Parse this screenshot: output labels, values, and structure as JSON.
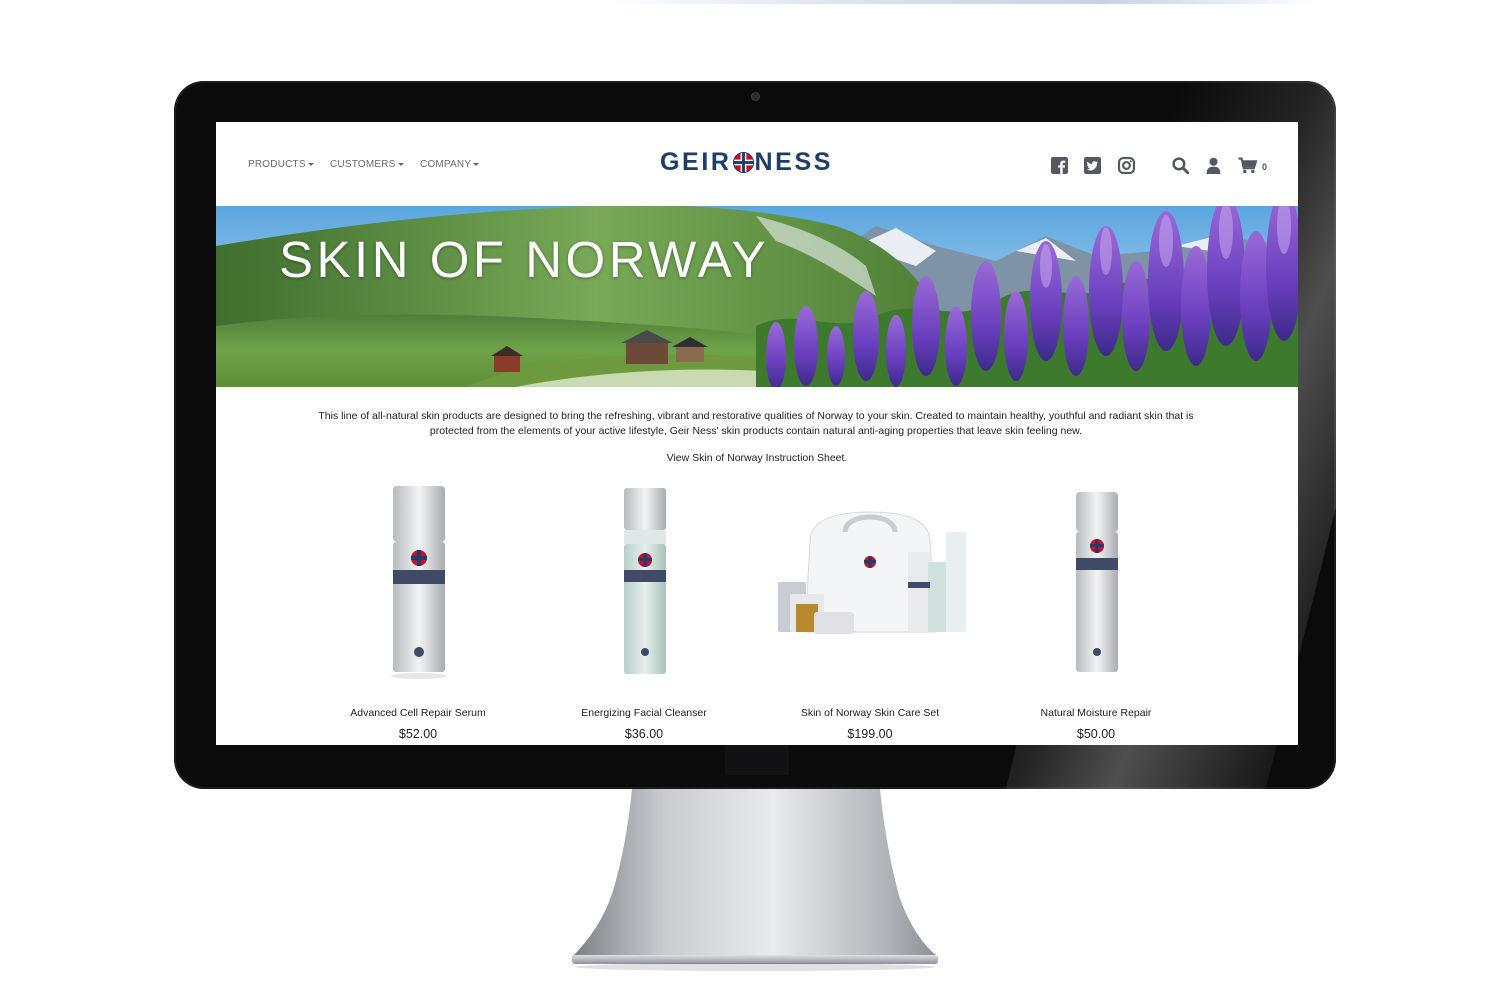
{
  "nav": {
    "menu": [
      {
        "label": "PRODUCTS"
      },
      {
        "label": "CUSTOMERS"
      },
      {
        "label": "COMPANY"
      }
    ],
    "logo_left": "GEIR",
    "logo_right": "NESS",
    "social_icons": [
      "facebook-icon",
      "twitter-icon",
      "instagram-icon"
    ],
    "utility_icons": [
      "search-icon",
      "user-icon",
      "cart-icon"
    ],
    "cart_count": "0"
  },
  "hero": {
    "title": "SKIN OF NORWAY"
  },
  "intro": {
    "text": "This line of all-natural skin products are designed to bring the refreshing, vibrant and restorative qualities of Norway to your skin. Created to maintain healthy, youthful and radiant skin that is protected from the elements of your active lifestyle, Geir Ness' skin products contain natural anti-aging properties that leave skin feeling new.",
    "link": "View Skin of Norway Instruction Sheet."
  },
  "products": [
    {
      "name": "Advanced Cell Repair Serum",
      "price": "$52.00"
    },
    {
      "name": "Energizing Facial Cleanser",
      "price": "$36.00"
    },
    {
      "name": "Skin of Norway Skin Care Set",
      "price": "$199.00"
    },
    {
      "name": "Natural Moisture Repair",
      "price": "$50.00"
    }
  ],
  "colors": {
    "brand_navy": "#1f3d66",
    "flag_red": "#c8102e",
    "flag_blue": "#1f3d66"
  }
}
